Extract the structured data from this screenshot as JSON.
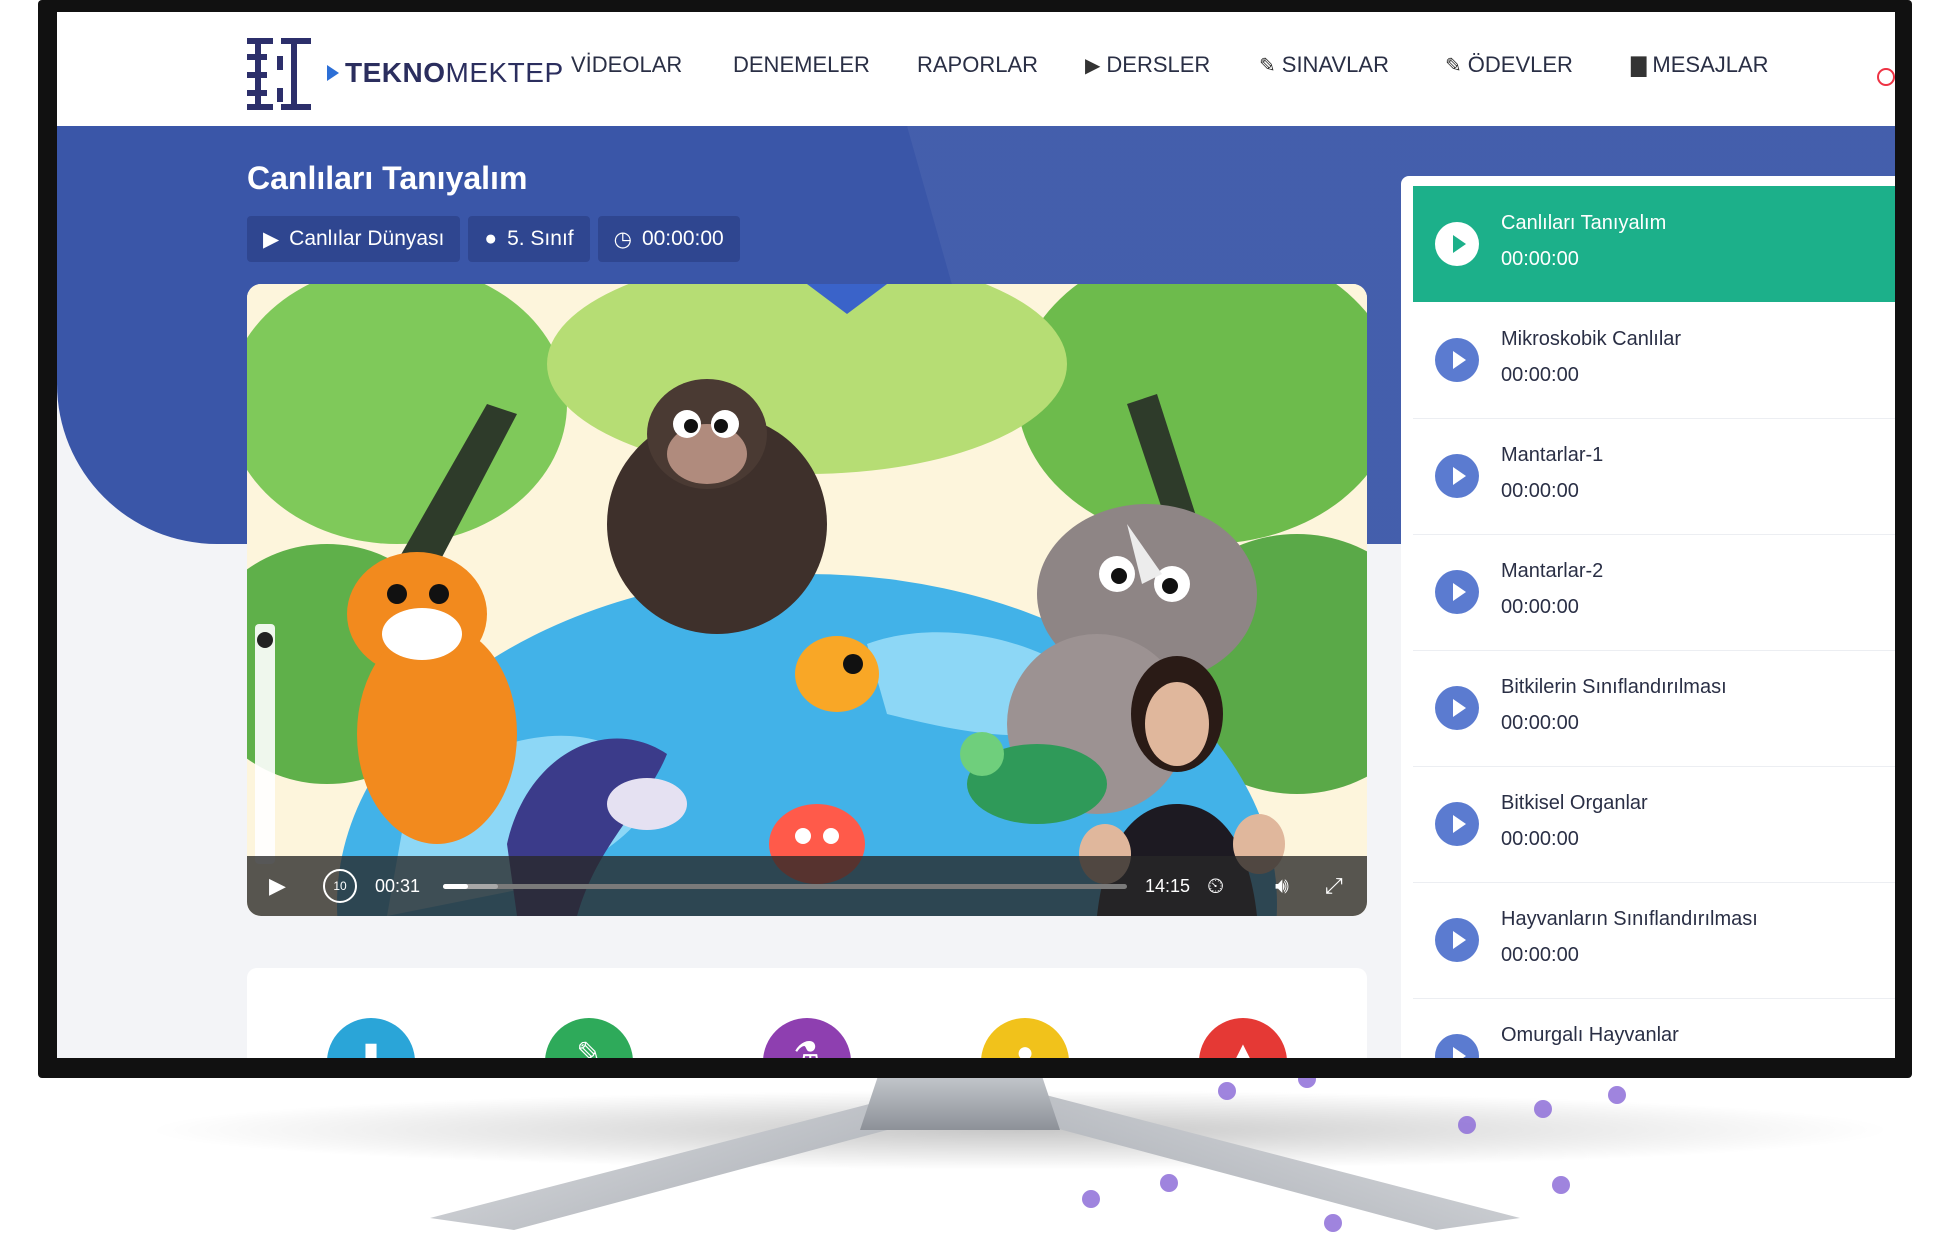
{
  "brand": {
    "logo_bold": "TEKNO",
    "logo_rest": "MEKTEP"
  },
  "nav": [
    {
      "label": "VİDEOLAR",
      "icon": ""
    },
    {
      "label": "DENEMELER",
      "icon": ""
    },
    {
      "label": "RAPORLAR",
      "icon": ""
    },
    {
      "label": "DERSLER",
      "icon": "play-icon"
    },
    {
      "label": "SINAVLAR",
      "icon": "pencil-icon"
    },
    {
      "label": "ÖDEVLER",
      "icon": "pencil-icon"
    },
    {
      "label": "MESAJLAR",
      "icon": "message-icon"
    }
  ],
  "video": {
    "title": "Canlıları Tanıyalım",
    "chips": {
      "course": "Canlılar Dünyası",
      "grade": "5. Sınıf",
      "duration": "00:00:00"
    },
    "player": {
      "current_time": "00:31",
      "total_time": "14:15",
      "progress": 0.036,
      "buffered": 0.08,
      "rewind_seconds": "10"
    }
  },
  "actions": [
    {
      "icon": "document-icon",
      "color": "#2aa5d8"
    },
    {
      "icon": "pencil-icon",
      "color": "#2eaa5a"
    },
    {
      "icon": "flask-icon",
      "color": "#8e3fb0"
    },
    {
      "icon": "chat-icon",
      "color": "#f1c21b"
    },
    {
      "icon": "warning-icon",
      "color": "#e53935"
    }
  ],
  "playlist": [
    {
      "title": "Canlıları Tanıyalım",
      "time": "00:00:00",
      "active": true
    },
    {
      "title": "Mikroskobik Canlılar",
      "time": "00:00:00"
    },
    {
      "title": "Mantarlar-1",
      "time": "00:00:00"
    },
    {
      "title": "Mantarlar-2",
      "time": "00:00:00"
    },
    {
      "title": "Bitkilerin Sınıflandırılması",
      "time": "00:00:00"
    },
    {
      "title": "Bitkisel Organlar",
      "time": "00:00:00"
    },
    {
      "title": "Hayvanların Sınıflandırılması",
      "time": "00:00:00"
    },
    {
      "title": "Omurgalı Hayvanlar",
      "time": ""
    }
  ],
  "colors": {
    "band": "#3a56a8",
    "active_item": "#1cb08a",
    "play_icon": "#5b7bd0"
  }
}
